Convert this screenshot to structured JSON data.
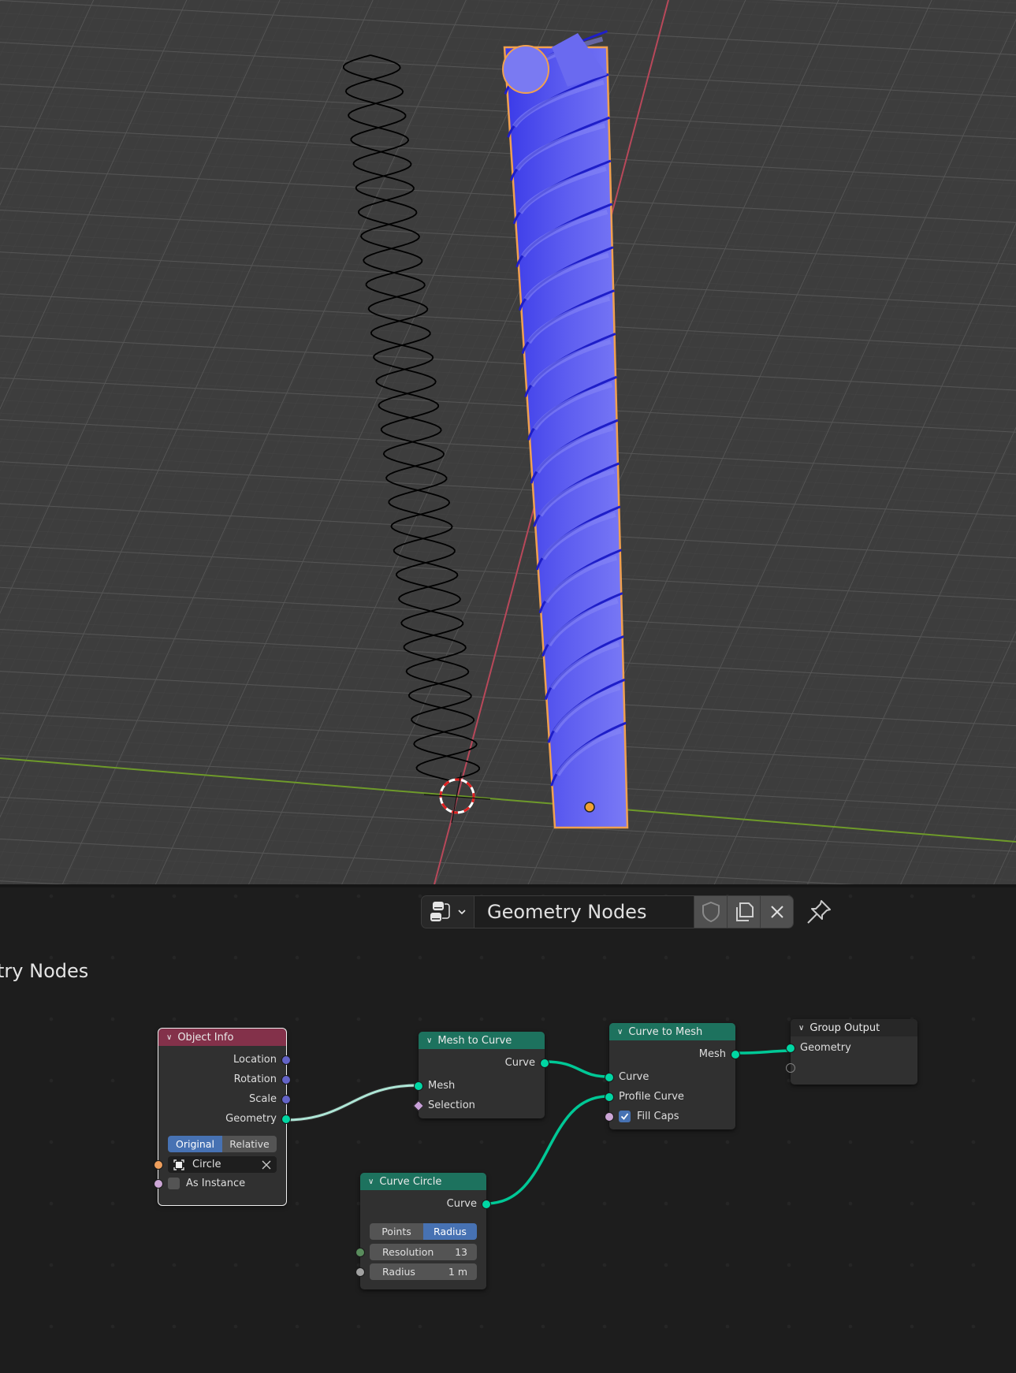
{
  "viewport": {
    "background": "#3d3d3d",
    "axis_x_color": "#b8485a",
    "axis_y_color": "#6e9a2a",
    "helix_curve_color": "#000000",
    "mesh_color": "#5555ee",
    "selection_outline_color": "#f0a050"
  },
  "header": {
    "editor_type_icon": "node-editor-icon",
    "node_tree_name": "Geometry Nodes",
    "fake_user_icon": "shield-icon",
    "duplicate_icon": "duplicate-icon",
    "unlink_icon": "close-icon",
    "pin_icon": "pin-icon"
  },
  "tree_title": "try Nodes",
  "nodes": {
    "object_info": {
      "title": "Object Info",
      "header_color": "#83314a",
      "outputs": [
        "Location",
        "Rotation",
        "Scale",
        "Geometry"
      ],
      "transform_space": {
        "options": [
          "Original",
          "Relative"
        ],
        "selected": "Original"
      },
      "object": "Circle",
      "as_instance_label": "As Instance",
      "as_instance": false
    },
    "mesh_to_curve": {
      "title": "Mesh to Curve",
      "header_color": "#1d725e",
      "outputs": [
        "Curve"
      ],
      "inputs": [
        "Mesh",
        "Selection"
      ]
    },
    "curve_to_mesh": {
      "title": "Curve to Mesh",
      "header_color": "#1d725e",
      "outputs": [
        "Mesh"
      ],
      "inputs": [
        "Curve",
        "Profile Curve"
      ],
      "fill_caps_label": "Fill Caps",
      "fill_caps": true
    },
    "group_output": {
      "title": "Group Output",
      "header_color": "#272727",
      "inputs": [
        "Geometry"
      ]
    },
    "curve_circle": {
      "title": "Curve Circle",
      "header_color": "#1d725e",
      "outputs": [
        "Curve"
      ],
      "mode": {
        "options": [
          "Points",
          "Radius"
        ],
        "selected": "Radius"
      },
      "resolution_label": "Resolution",
      "resolution": "13",
      "radius_label": "Radius",
      "radius": "1 m"
    }
  },
  "socket_colors": {
    "geometry": "#00d6a3",
    "vector": "#6363c7",
    "object": "#ed9e5c",
    "boolean": "#cca6d6",
    "integer": "#598c5c",
    "float": "#a1a1a1"
  }
}
